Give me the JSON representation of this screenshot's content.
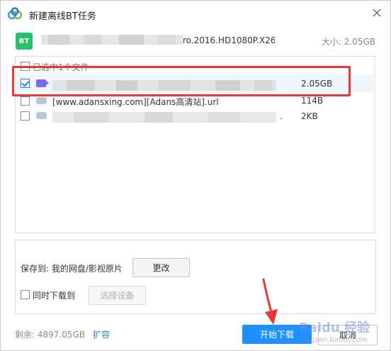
{
  "window": {
    "title": "新建离线BT任务",
    "logo_icon": "baidu-netdisk-logo-icon",
    "close_icon": "close-icon"
  },
  "task": {
    "badge": "BT",
    "name_visible_part": "ro.2016.HD1080P.X26...",
    "total_size": "大小: 2.05GB"
  },
  "file_list": {
    "select_all_label": "已选中1个文件",
    "files": [
      {
        "name": "",
        "size": "2.05GB",
        "checked": true,
        "icon": "video-file-icon"
      },
      {
        "name": "[www.adansxing.com][Adans高清站].url",
        "size": "114B",
        "checked": false,
        "icon": "cloud-file-icon"
      },
      {
        "name": ".",
        "size": "2KB",
        "checked": false,
        "icon": "cloud-file-icon"
      }
    ]
  },
  "save": {
    "label": "保存到: 我的网盘/影视原片",
    "change_button": "更改",
    "simultaneous_label": "同时下载到",
    "select_device_button": "选择设备"
  },
  "footer": {
    "remaining": "剩余: 4897.05GB",
    "expand_link": "扩容",
    "start_button": "开始下载",
    "cancel_button": "取消"
  },
  "colors": {
    "primary": "#1e90ff",
    "highlight": "#e53935",
    "bt_badge": "#28c06a",
    "video_icon": "#7b68ee",
    "link": "#2a7fd8"
  },
  "watermark": {
    "text": "Baidu 经验",
    "subtext": "jingyan.baidu.com"
  }
}
